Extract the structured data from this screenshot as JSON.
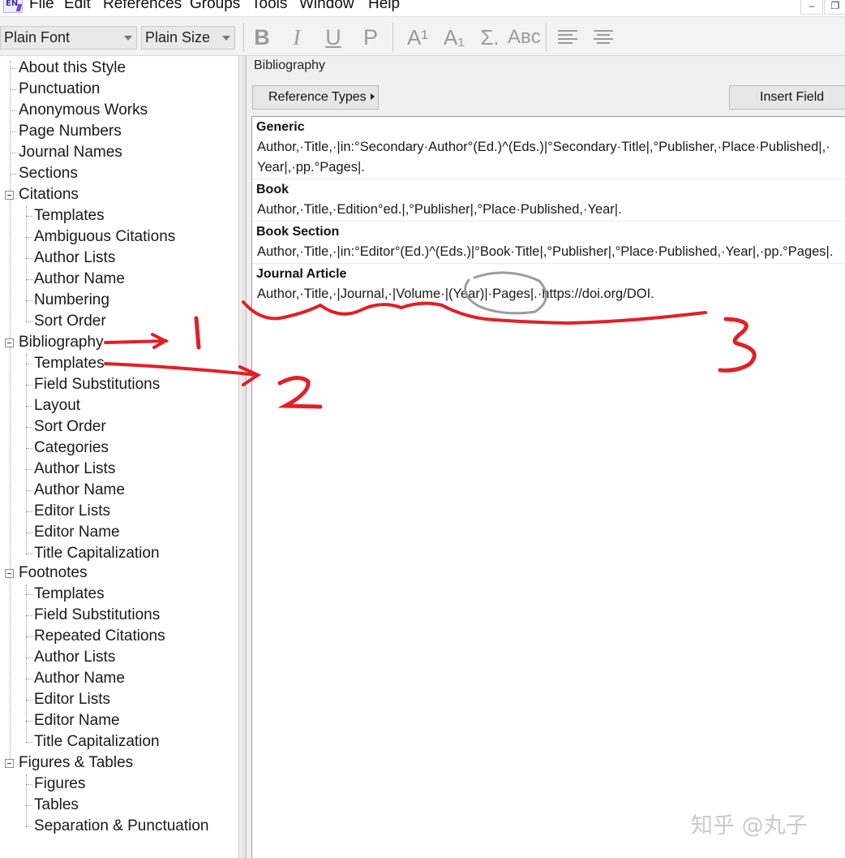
{
  "app": {
    "icon_text": "EN"
  },
  "menu": [
    "File",
    "Edit",
    "References",
    "Groups",
    "Tools",
    "Window",
    "Help"
  ],
  "window_buttons": {
    "minimize": "–",
    "restore": "❐"
  },
  "toolbar": {
    "font_select": "Plain Font",
    "size_select": "Plain Size",
    "bold": "B",
    "italic": "I",
    "underline": "U",
    "plain": "P",
    "superscript": "A¹",
    "subscript": "A₁",
    "symbol": "Σ.",
    "smallcaps": "Aʙc"
  },
  "tree": {
    "top_items": [
      "About this Style",
      "Punctuation",
      "Anonymous Works",
      "Page Numbers",
      "Journal Names",
      "Sections"
    ],
    "citations": {
      "label": "Citations",
      "children": [
        "Templates",
        "Ambiguous Citations",
        "Author Lists",
        "Author Name",
        "Numbering",
        "Sort Order"
      ]
    },
    "bibliography": {
      "label": "Bibliography",
      "children": [
        "Templates",
        "Field Substitutions",
        "Layout",
        "Sort Order",
        "Categories",
        "Author Lists",
        "Author Name",
        "Editor Lists",
        "Editor Name",
        "Title Capitalization"
      ]
    },
    "footnotes": {
      "label": "Footnotes",
      "children": [
        "Templates",
        "Field Substitutions",
        "Repeated Citations",
        "Author Lists",
        "Author Name",
        "Editor Lists",
        "Editor Name",
        "Title Capitalization"
      ]
    },
    "figures": {
      "label": "Figures & Tables",
      "children": [
        "Figures",
        "Tables",
        "Separation & Punctuation"
      ]
    }
  },
  "panel": {
    "title": "Bibliography",
    "reference_types_button": "Reference Types",
    "insert_field_button": "Insert Field"
  },
  "templates": [
    {
      "type": "Generic",
      "lines": [
        "Author,·Title,·|in:°Secondary·Author°(Ed.)^(Eds.)|°Secondary·Title|,°Publisher,·Place·Published|,·",
        "Year|,·pp.°Pages|."
      ]
    },
    {
      "type": "Book",
      "lines": [
        "Author,·Title,·Edition°ed.|,°Publisher|,°Place·Published,·Year|."
      ]
    },
    {
      "type": "Book Section",
      "lines": [
        "Author,·Title,·|in:°Editor°(Ed.)^(Eds.)|°Book·Title|,°Publisher|,°Place·Published,·Year|,·pp.°Pages|."
      ]
    },
    {
      "type": "Journal Article",
      "lines": [
        "Author,·Title,·|Journal,·|Volume·|(Year)|·Pages|.·https://doi.org/DOI."
      ]
    }
  ],
  "annotations": [
    "1",
    "2",
    "3"
  ],
  "watermark": "知乎 @丸子"
}
